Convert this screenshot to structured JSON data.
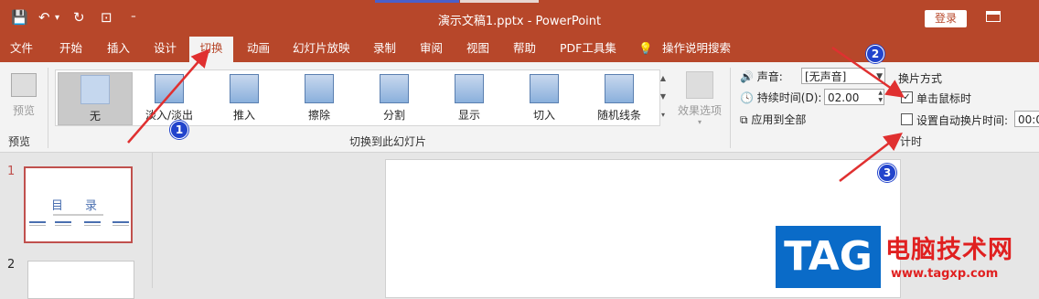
{
  "titlebar": {
    "doc_title": "演示文稿1.pptx  -  PowerPoint",
    "login": "登录",
    "qat_save": "💾",
    "qat_undo": "↶",
    "qat_undo_dd": "▾",
    "qat_redo": "↻",
    "qat_present": "⊡",
    "qat_customize": "⁼"
  },
  "tabs": [
    {
      "label": "文件"
    },
    {
      "label": "开始"
    },
    {
      "label": "插入"
    },
    {
      "label": "设计"
    },
    {
      "label": "切换",
      "active": true
    },
    {
      "label": "动画"
    },
    {
      "label": "幻灯片放映"
    },
    {
      "label": "录制"
    },
    {
      "label": "审阅"
    },
    {
      "label": "视图"
    },
    {
      "label": "帮助"
    },
    {
      "label": "PDF工具集"
    },
    {
      "label": "操作说明搜索",
      "icon": "lightbulb-icon"
    }
  ],
  "ribbon": {
    "preview": {
      "button": "预览",
      "group": "预览"
    },
    "transitions": {
      "items": [
        "无",
        "淡入/淡出",
        "推入",
        "擦除",
        "分割",
        "显示",
        "切入",
        "随机线条"
      ],
      "selected": "无",
      "group": "切换到此幻灯片"
    },
    "effect_options": "效果选项",
    "timing": {
      "sound_label": "声音:",
      "sound_value": "[无声音]",
      "duration_label": "持续时间(D):",
      "duration_value": "02.00",
      "apply_all": "应用到全部",
      "advance_title": "换片方式",
      "on_click": "单击鼠标时",
      "on_click_checked": true,
      "after_label": "设置自动换片时间:",
      "after_checked": false,
      "after_value": "00:0",
      "group": "计时"
    }
  },
  "slides": {
    "numbers": [
      "1",
      "2"
    ],
    "thumb1_title": "目录"
  },
  "annotations": [
    "1",
    "2",
    "3"
  ],
  "watermark": {
    "tag": "TAG",
    "cn": "电脑技术网",
    "url": "www.tagxp.com"
  },
  "colors": {
    "brand": "#b7472a",
    "arrow": "#e03030",
    "badge": "#2244cc"
  }
}
